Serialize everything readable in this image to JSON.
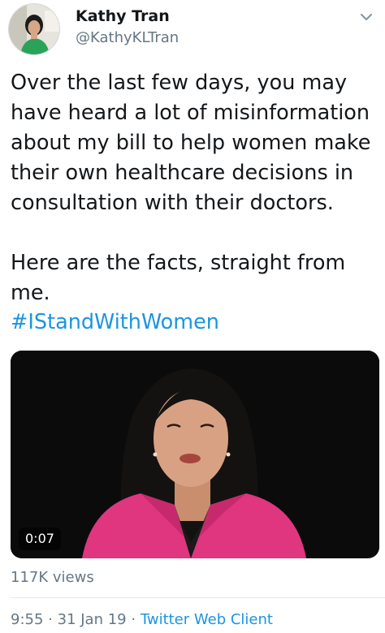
{
  "author": {
    "name": "Kathy Tran",
    "handle": "@KathyKLTran"
  },
  "tweet": {
    "text": "Over the last few days, you may have heard a lot of misinformation about my bill to help women make their own healthcare decisions in consultation with their doctors.\n\nHere are the facts, straight from me.",
    "hashtag": "#IStandWithWomen"
  },
  "video": {
    "duration": "0:07",
    "views": "117K views"
  },
  "meta": {
    "time": "9:55",
    "separator": "·",
    "date": "31 Jan 19",
    "client": "Twitter Web Client"
  },
  "colors": {
    "link": "#1b95e0",
    "secondary": "#657786",
    "jacket": "#e0357f"
  },
  "icons": {
    "more": "chevron-down-icon"
  }
}
